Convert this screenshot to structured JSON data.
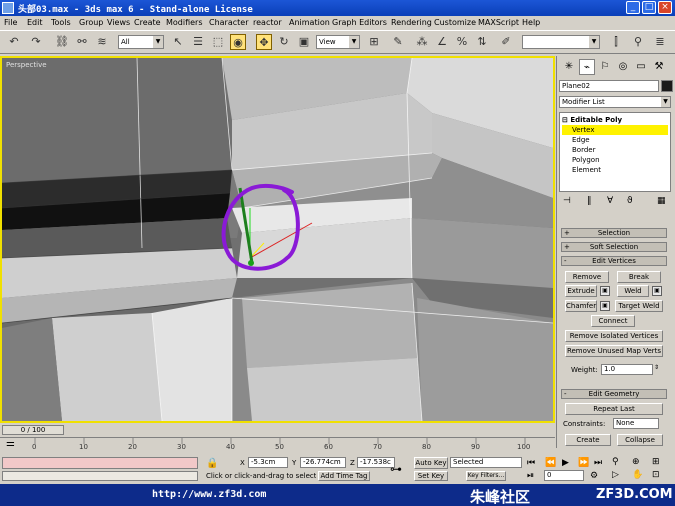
{
  "window": {
    "title": "头部03.max - 3ds max 6 - Stand-alone License"
  },
  "menu": [
    "File",
    "Edit",
    "Tools",
    "Group",
    "Views",
    "Create",
    "Modifiers",
    "Character",
    "reactor",
    "Animation",
    "Graph Editors",
    "Rendering",
    "Customize",
    "MAXScript",
    "Help"
  ],
  "toolbar": {
    "selection_filter": "All",
    "reference_coord": "View",
    "named_selection": ""
  },
  "viewport": {
    "label": "Perspective"
  },
  "command_panel": {
    "object_name": "Plane02",
    "modifier_list": "Modifier List",
    "stack": {
      "root": "Editable Poly",
      "items": [
        "Vertex",
        "Edge",
        "Border",
        "Polygon",
        "Element"
      ],
      "selected": "Vertex"
    },
    "rollouts": {
      "selection": "Selection",
      "soft_selection": "Soft Selection",
      "edit_vertices": "Edit Vertices",
      "edit_geometry": "Edit Geometry"
    },
    "edit_vertices": {
      "remove": "Remove",
      "break": "Break",
      "extrude": "Extrude",
      "weld": "Weld",
      "chamfer": "Chamfer",
      "target_weld": "Target Weld",
      "connect": "Connect",
      "remove_isolated": "Remove Isolated Vertices",
      "remove_unused_map": "Remove Unused Map Verts",
      "weight_label": "Weight:",
      "weight_value": "1.0"
    },
    "edit_geometry": {
      "repeat_last": "Repeat Last",
      "constraints_label": "Constraints:",
      "constraints_value": "None",
      "create": "Create",
      "collapse": "Collapse"
    }
  },
  "timeline": {
    "frame_display": "0 / 100",
    "ticks": [
      "0",
      "10",
      "20",
      "30",
      "40",
      "50",
      "60",
      "70",
      "80",
      "90",
      "100"
    ]
  },
  "status": {
    "prompt": "Click or click-and-drag to select ob",
    "x_label": "X",
    "x_value": "-5.3cm",
    "y_label": "Y",
    "y_value": "-26.774cm",
    "z_label": "Z",
    "z_value": "-17.538c",
    "add_time_tag": "Add Time Tag",
    "auto_key": "Auto Key",
    "set_key": "Set Key",
    "key_mode": "Selected",
    "key_filters": "Key Filters...",
    "frame": "0"
  },
  "banner": {
    "url": "http://www.zf3d.com",
    "chinese": "朱峰社区",
    "brand": "ZF3D.COM"
  },
  "colors": {
    "viewport_border": "#f0e000",
    "selected_subobject": "#fff200",
    "annotation_circle": "#8a1ad6",
    "banner": "#0d2b8a"
  }
}
